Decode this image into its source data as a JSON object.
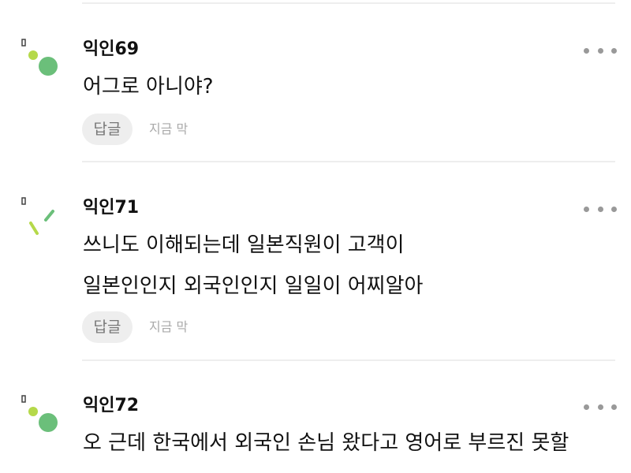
{
  "comments": [
    {
      "nickname": "익인69",
      "lines": [
        "어그로 아니야?"
      ],
      "reply_label": "답글",
      "timestamp": "지금 막",
      "avatar": "green-dots-avatar-icon"
    },
    {
      "nickname": "익인71",
      "lines": [
        "쓰니도 이해되는데 일본직원이 고객이",
        "일본인인지 외국인인지 일일이 어찌알아"
      ],
      "reply_label": "답글",
      "timestamp": "지금 막",
      "avatar": "green-strokes-avatar-icon"
    },
    {
      "nickname": "익인72",
      "lines": [
        "오 근데 한국에서 외국인 손님 왔다고 영어로 부르진 못할"
      ],
      "reply_label": "",
      "timestamp": "",
      "avatar": "green-dots-avatar-icon"
    }
  ],
  "colors": {
    "avatar_green_dark": "#6bbf7a",
    "avatar_green_light": "#b5d94a",
    "text": "#111111",
    "muted": "#aaaaaa",
    "divider": "#eeeeee",
    "reply_bg": "#eeeeee"
  }
}
